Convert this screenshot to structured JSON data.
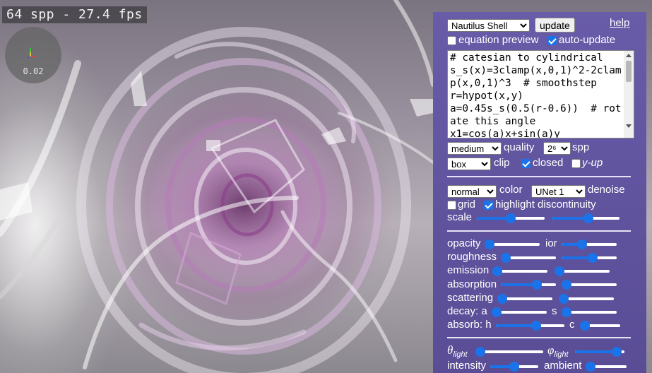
{
  "overlay": {
    "fps_text": "64 spp - 27.4 fps",
    "gizmo_scale": "0.02"
  },
  "panel": {
    "preset": {
      "selected": "Nautilus Shell"
    },
    "update_label": "update",
    "help_label": "help",
    "equation_preview": {
      "label": "equation preview",
      "checked": false
    },
    "auto_update": {
      "label": "auto-update",
      "checked": true
    },
    "equation_text": "# catesian to cylindrical\ns_s(x)=3clamp(x,0,1)^2-2clamp(x,0,1)^3  # smoothstep\nr=hypot(x,y)\na=0.45s_s(0.5(r-0.6))  # rotate this angle\nx1=cos(a)x+sin(a)y",
    "quality": {
      "selected": "medium",
      "label": "quality"
    },
    "spp": {
      "selected": "2⁶",
      "label": "spp"
    },
    "clip": {
      "selected": "box",
      "label": "clip"
    },
    "closed": {
      "label": "closed",
      "checked": true
    },
    "y_up": {
      "label": "y-up",
      "checked": false
    },
    "color": {
      "selected": "normal",
      "label": "color"
    },
    "denoise": {
      "selected": "UNet 1",
      "label": "denoise"
    },
    "grid": {
      "label": "grid",
      "checked": false
    },
    "highlight": {
      "label": "highlight discontinuity",
      "checked": true
    },
    "scale_label": "scale",
    "labels": {
      "opacity": "opacity",
      "ior": "ior",
      "roughness": "roughness",
      "emission": "emission",
      "absorption": "absorption",
      "scattering": "scattering",
      "decay_a": "decay: a",
      "decay_s": "s",
      "absorb_h": "absorb: h",
      "absorb_c": "c",
      "theta_symbol": "θ",
      "theta_sub": "light",
      "phi_symbol": "φ",
      "phi_sub": "light",
      "intensity": "intensity",
      "ambient": "ambient"
    },
    "sliders": {
      "scale_1": 0.5,
      "scale_2": 0.55,
      "opacity": 0.0,
      "ior": 0.35,
      "roughness_1": 0.0,
      "roughness_2": 0.58,
      "emission_1": 0.0,
      "emission_2": 0.0,
      "absorption_1": 0.68,
      "absorption_2": 0.0,
      "scattering_1": 0.0,
      "scattering_2": 0.0,
      "decay_a": 0.0,
      "decay_s": 0.0,
      "absorb_h": 0.6,
      "absorb_c": 0.0,
      "theta_light": 0.0,
      "phi_light": 0.93,
      "intensity": 0.5,
      "ambient": 0.0
    }
  },
  "colors": {
    "panel_bg": "#5f52a0",
    "accent": "#1a73e8"
  }
}
